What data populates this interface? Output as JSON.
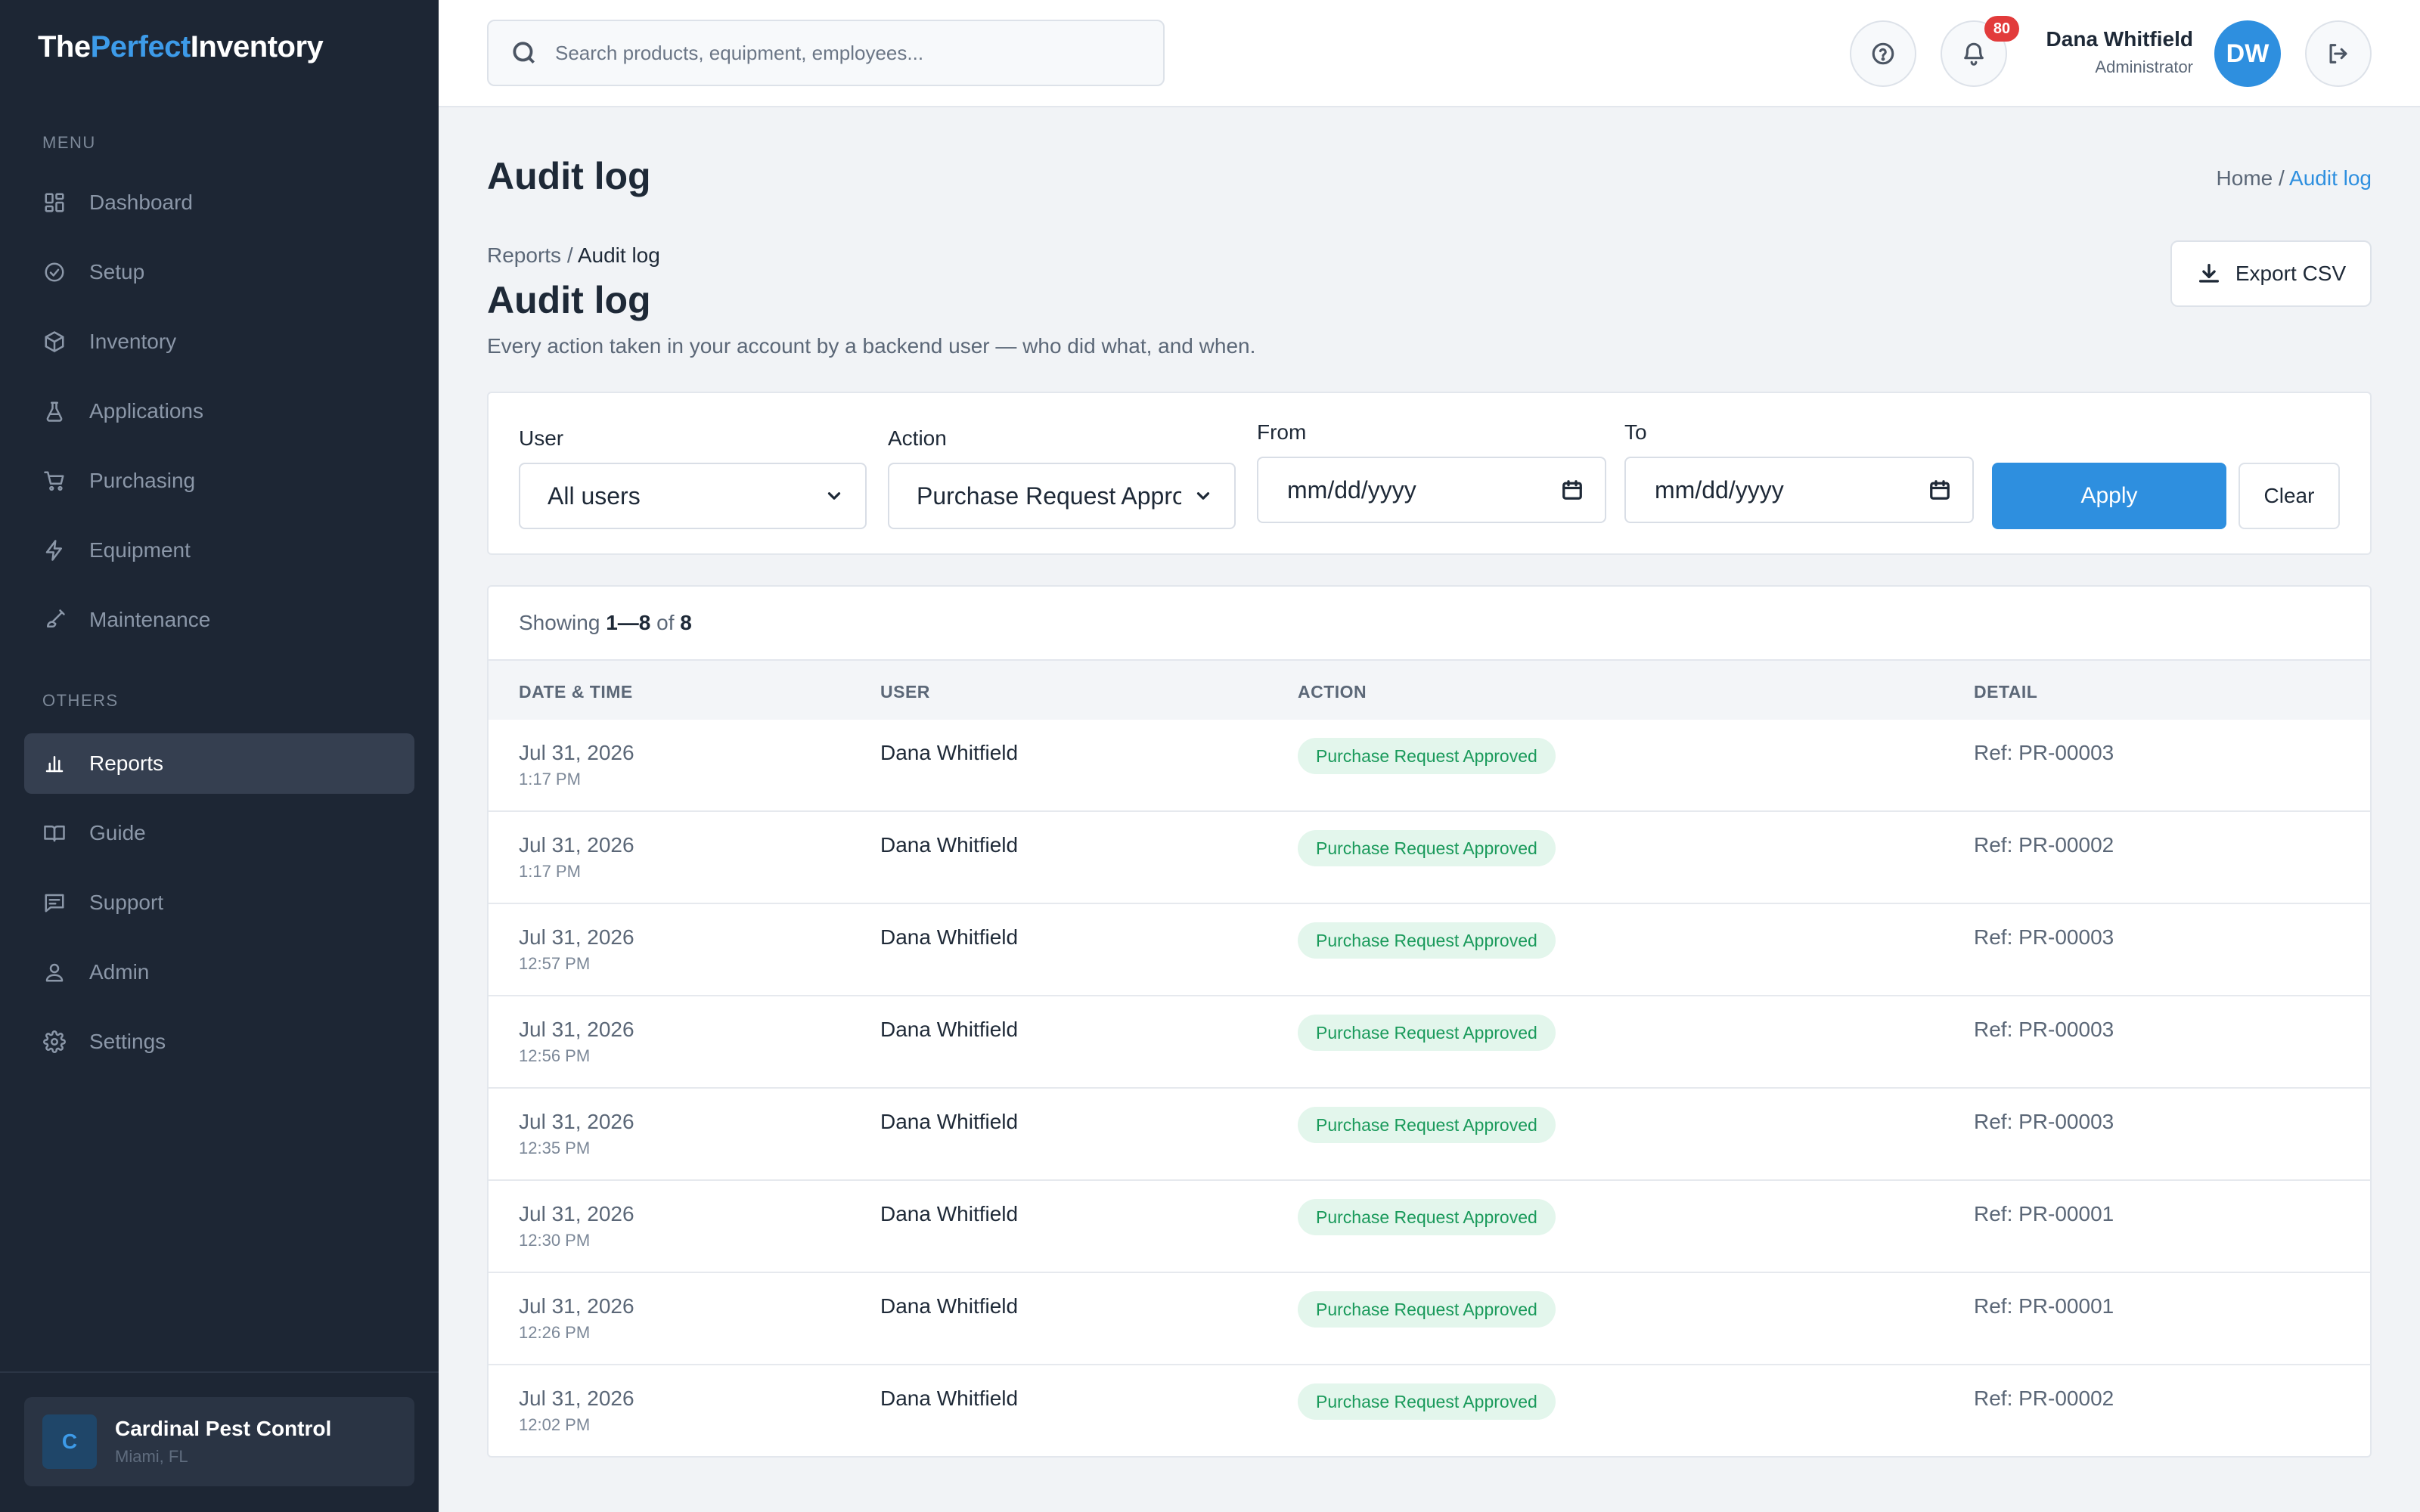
{
  "app": {
    "logo_part1": "The",
    "logo_part2": "Perfect",
    "logo_part3": "Inventory"
  },
  "sidebar": {
    "menu_label": "MENU",
    "others_label": "OTHERS",
    "menu_items": [
      {
        "label": "Dashboard",
        "icon": "grid-icon"
      },
      {
        "label": "Setup",
        "icon": "check-circle-icon"
      },
      {
        "label": "Inventory",
        "icon": "box-icon"
      },
      {
        "label": "Applications",
        "icon": "flask-icon"
      },
      {
        "label": "Purchasing",
        "icon": "cart-icon"
      },
      {
        "label": "Equipment",
        "icon": "bolt-icon"
      },
      {
        "label": "Maintenance",
        "icon": "brush-icon"
      }
    ],
    "other_items": [
      {
        "label": "Reports",
        "icon": "bar-chart-icon",
        "active": true
      },
      {
        "label": "Guide",
        "icon": "book-icon"
      },
      {
        "label": "Support",
        "icon": "chat-icon"
      },
      {
        "label": "Admin",
        "icon": "user-icon"
      },
      {
        "label": "Settings",
        "icon": "gear-icon"
      }
    ],
    "company": {
      "initial": "C",
      "name": "Cardinal Pest Control",
      "location": "Miami, FL"
    }
  },
  "header": {
    "search_placeholder": "Search products, equipment, employees...",
    "notification_count": "80",
    "user_name": "Dana Whitfield",
    "user_role": "Administrator",
    "user_initials": "DW"
  },
  "page": {
    "title": "Audit log",
    "breadcrumb_home": "Home",
    "breadcrumb_sep": " / ",
    "breadcrumb_current": "Audit log",
    "sub_crumb_parent": "Reports",
    "sub_crumb_current": "Audit log",
    "section_title": "Audit log",
    "section_desc": "Every action taken in your account by a backend user — who did what, and when.",
    "export_label": "Export CSV"
  },
  "filters": {
    "user_label": "User",
    "user_value": "All users",
    "action_label": "Action",
    "action_value": "Purchase Request Approved",
    "from_label": "From",
    "from_value": "mm/dd/yyyy",
    "to_label": "To",
    "to_value": "mm/dd/yyyy",
    "apply_label": "Apply",
    "clear_label": "Clear"
  },
  "table": {
    "showing_prefix": "Showing ",
    "showing_range": "1—8",
    "showing_of": " of ",
    "showing_total": "8",
    "columns": [
      "DATE & TIME",
      "USER",
      "ACTION",
      "DETAIL"
    ],
    "rows": [
      {
        "date": "Jul 31, 2026",
        "time": "1:17 PM",
        "user": "Dana Whitfield",
        "action": "Purchase Request Approved",
        "detail": "Ref: PR-00003"
      },
      {
        "date": "Jul 31, 2026",
        "time": "1:17 PM",
        "user": "Dana Whitfield",
        "action": "Purchase Request Approved",
        "detail": "Ref: PR-00002"
      },
      {
        "date": "Jul 31, 2026",
        "time": "12:57 PM",
        "user": "Dana Whitfield",
        "action": "Purchase Request Approved",
        "detail": "Ref: PR-00003"
      },
      {
        "date": "Jul 31, 2026",
        "time": "12:56 PM",
        "user": "Dana Whitfield",
        "action": "Purchase Request Approved",
        "detail": "Ref: PR-00003"
      },
      {
        "date": "Jul 31, 2026",
        "time": "12:35 PM",
        "user": "Dana Whitfield",
        "action": "Purchase Request Approved",
        "detail": "Ref: PR-00003"
      },
      {
        "date": "Jul 31, 2026",
        "time": "12:30 PM",
        "user": "Dana Whitfield",
        "action": "Purchase Request Approved",
        "detail": "Ref: PR-00001"
      },
      {
        "date": "Jul 31, 2026",
        "time": "12:26 PM",
        "user": "Dana Whitfield",
        "action": "Purchase Request Approved",
        "detail": "Ref: PR-00001"
      },
      {
        "date": "Jul 31, 2026",
        "time": "12:02 PM",
        "user": "Dana Whitfield",
        "action": "Purchase Request Approved",
        "detail": "Ref: PR-00002"
      }
    ]
  },
  "colors": {
    "sidebar_bg": "#1d2634",
    "accent": "#2e8fdf",
    "success_text": "#1a9a5b",
    "success_bg": "#e3f6ec",
    "badge_red": "#e23b3b"
  }
}
